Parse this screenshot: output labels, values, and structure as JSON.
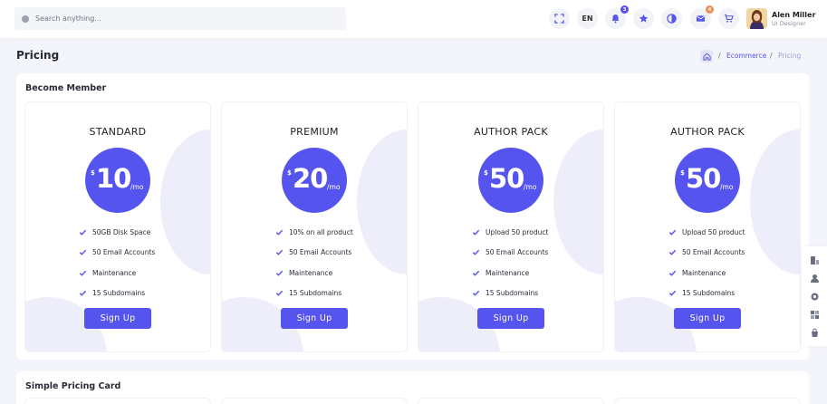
{
  "header": {
    "search_placeholder": "Search anything...",
    "language": "EN",
    "notifications_count": "3",
    "messages_count": "4",
    "user": {
      "name": "Alen Miller",
      "role": "UI Designer"
    },
    "icons": [
      "fullscreen-icon",
      "bell-icon",
      "star-icon",
      "theme-toggle-icon",
      "mail-icon",
      "cart-icon"
    ]
  },
  "page": {
    "title": "Pricing",
    "breadcrumb": {
      "sep": "/",
      "parent": "Ecommerce",
      "current": "Pricing"
    }
  },
  "section1": {
    "title": "Become Member",
    "plans": [
      {
        "name": "STANDARD",
        "currency": "$",
        "price": "10",
        "period": "/mo",
        "features": [
          "50GB Disk Space",
          "50 Email Accounts",
          "Maintenance",
          "15 Subdomains"
        ],
        "cta": "Sign Up"
      },
      {
        "name": "PREMIUM",
        "currency": "$",
        "price": "20",
        "period": "/mo",
        "features": [
          "10% on all product",
          "50 Email Accounts",
          "Maintenance",
          "15 Subdomains"
        ],
        "cta": "Sign Up"
      },
      {
        "name": "AUTHOR PACK",
        "currency": "$",
        "price": "50",
        "period": "/mo",
        "features": [
          "Upload 50 product",
          "50 Email Accounts",
          "Maintenance",
          "15 Subdomains"
        ],
        "cta": "Sign Up"
      },
      {
        "name": "AUTHOR PACK",
        "currency": "$",
        "price": "50",
        "period": "/mo",
        "features": [
          "Upload 50 product",
          "50 Email Accounts",
          "Maintenance",
          "15 Subdomains"
        ],
        "cta": "Sign Up"
      }
    ]
  },
  "section2": {
    "title": "Simple Pricing Card"
  },
  "colors": {
    "accent": "#5654ee",
    "accent_light": "#eeeefb",
    "badge_orange": "#f28b50"
  }
}
